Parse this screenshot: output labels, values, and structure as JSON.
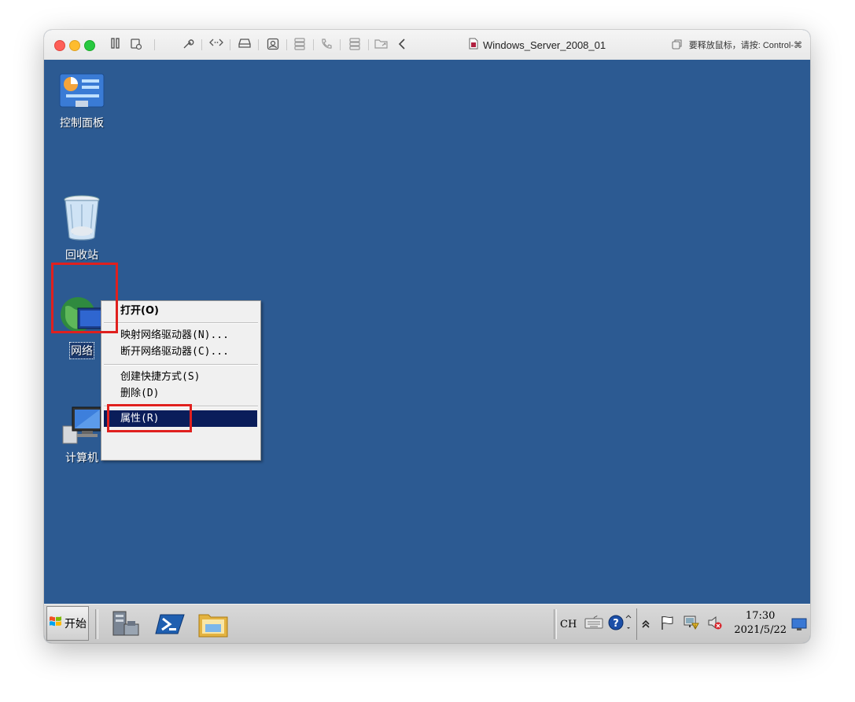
{
  "window": {
    "title": "Windows_Server_2008_01",
    "release_hint": "要释放鼠标，请按: Control-⌘"
  },
  "toolbar_icons": [
    "pause-icon",
    "snapshot-icon",
    "settings-wrench-icon",
    "code-brackets-icon",
    "disk-drive-icon",
    "user-account-icon",
    "storage-icon",
    "phone-icon",
    "print-icon",
    "shared-folder-icon",
    "back-chevron-icon"
  ],
  "desktop": {
    "background_color": "#2c5a92",
    "icons": [
      {
        "name": "control-panel-icon",
        "label": "控制面板"
      },
      {
        "name": "recycle-bin-icon",
        "label": "回收站"
      },
      {
        "name": "network-icon",
        "label": "网络",
        "selected": true
      },
      {
        "name": "computer-icon",
        "label": "计算机"
      }
    ]
  },
  "context_menu": {
    "items": [
      {
        "label": "打开(O)",
        "bold": true
      },
      {
        "label": "映射网络驱动器(N)..."
      },
      {
        "label": "断开网络驱动器(C)..."
      },
      {
        "label": "创建快捷方式(S)"
      },
      {
        "label": "删除(D)"
      },
      {
        "label": "属性(R)",
        "highlighted": true
      }
    ]
  },
  "annotations": {
    "color": "#e0201e"
  },
  "taskbar": {
    "start_label": "开始",
    "quick_launch": [
      "server-manager-icon",
      "powershell-icon",
      "explorer-folder-icon"
    ],
    "tray": {
      "language": "CH",
      "icons": [
        "keyboard-icon",
        "help-icon",
        "options-arrow-icon",
        "show-hidden-icon",
        "action-center-flag-icon",
        "network-status-icon",
        "volume-muted-icon",
        "desktop-icon"
      ]
    },
    "clock": {
      "time": "17:30",
      "date": "2021/5/22"
    }
  }
}
